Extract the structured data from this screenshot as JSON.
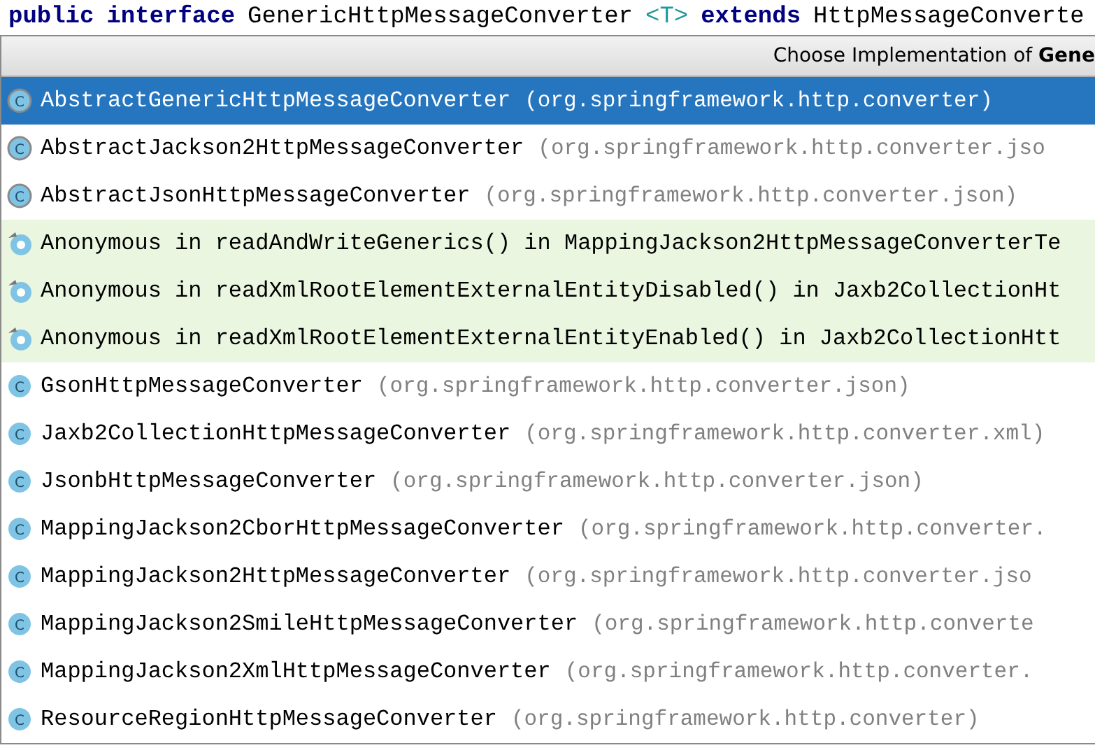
{
  "code_line": [
    {
      "text": "public",
      "kind": "keyword"
    },
    {
      "text": "interface",
      "kind": "keyword"
    },
    {
      "text": "GenericHttpMessageConverter",
      "kind": "name"
    },
    {
      "text": "<T>",
      "kind": "type_param"
    },
    {
      "text": "extends",
      "kind": "keyword"
    },
    {
      "text": "HttpMessageConverte",
      "kind": "name"
    }
  ],
  "popup": {
    "title": "Choose Implementation of **Gene**",
    "items": [
      {
        "kind": "abstract",
        "icon": "C",
        "name": "AbstractGenericHttpMessageConverter",
        "package": "(org.springframework.http.converter)",
        "selected": true
      },
      {
        "kind": "abstract",
        "icon": "C",
        "name": "AbstractJackson2HttpMessageConverter",
        "package": "(org.springframework.http.converter.jso",
        "selected": false
      },
      {
        "kind": "abstract",
        "icon": "C",
        "name": "AbstractJsonHttpMessageConverter",
        "package": "(org.springframework.http.converter.json)",
        "selected": false
      },
      {
        "kind": "anonymous",
        "name": "Anonymous in readAndWriteGenerics() in MappingJackson2HttpMessageConverterTe",
        "selected": false
      },
      {
        "kind": "anonymous",
        "name": "Anonymous in readXmlRootElementExternalEntityDisabled() in Jaxb2CollectionHt",
        "selected": false
      },
      {
        "kind": "anonymous",
        "name": "Anonymous in readXmlRootElementExternalEntityEnabled() in Jaxb2CollectionHtt",
        "selected": false
      },
      {
        "kind": "class",
        "icon": "C",
        "name": "GsonHttpMessageConverter",
        "package": "(org.springframework.http.converter.json)",
        "selected": false
      },
      {
        "kind": "class",
        "icon": "C",
        "name": "Jaxb2CollectionHttpMessageConverter",
        "package": "(org.springframework.http.converter.xml)",
        "selected": false
      },
      {
        "kind": "class",
        "icon": "C",
        "name": "JsonbHttpMessageConverter",
        "package": "(org.springframework.http.converter.json)",
        "selected": false
      },
      {
        "kind": "class",
        "icon": "C",
        "name": "MappingJackson2CborHttpMessageConverter",
        "package": "(org.springframework.http.converter.",
        "selected": false
      },
      {
        "kind": "class",
        "icon": "C",
        "name": "MappingJackson2HttpMessageConverter",
        "package": "(org.springframework.http.converter.jso",
        "selected": false
      },
      {
        "kind": "class",
        "icon": "C",
        "name": "MappingJackson2SmileHttpMessageConverter",
        "package": "(org.springframework.http.converte",
        "selected": false
      },
      {
        "kind": "class",
        "icon": "C",
        "name": "MappingJackson2XmlHttpMessageConverter",
        "package": "(org.springframework.http.converter.",
        "selected": false
      },
      {
        "kind": "class",
        "icon": "C",
        "name": "ResourceRegionHttpMessageConverter",
        "package": "(org.springframework.http.converter)",
        "selected": false
      }
    ]
  }
}
